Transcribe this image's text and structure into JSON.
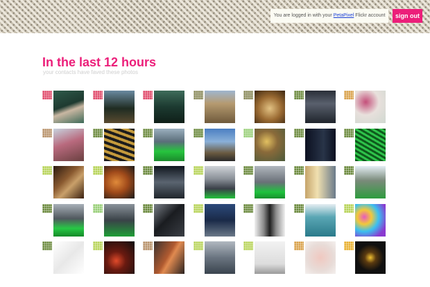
{
  "header": {
    "login_prefix": "You are logged in with your ",
    "login_link": "PetaPixel",
    "login_suffix": " Flickr account",
    "signout_label": "sign out"
  },
  "main": {
    "title": "In the last 12 hours",
    "subtitle": "your contacts have faved these photos"
  },
  "photos": [
    {
      "name": "woman-in-green-dress",
      "badge": "#e04a6a",
      "bg": "linear-gradient(160deg,#2e5a4a 0%,#1e3a30 45%,#c9b7a2 60%,#3d6a58 100%)"
    },
    {
      "name": "dark-trees",
      "badge": "#e04a6a",
      "bg": "linear-gradient(180deg,#6a8aa0 0%,#1f2c22 55%,#5a4a30 100%)"
    },
    {
      "name": "green-forest-road",
      "badge": "#e04a6a",
      "bg": "linear-gradient(180deg,#3e6b5a 0%,#1c3a30 50%,#0f1f18 100%)"
    },
    {
      "name": "rocky-mountain",
      "badge": "#8a8a5a",
      "bg": "linear-gradient(180deg,#9fb6cf 0%,#b59a70 40%,#6f5a3c 100%)"
    },
    {
      "name": "cathedral-interior",
      "badge": "#8a8a5a",
      "bg": "radial-gradient(circle at 50% 55%,#e2c283 0%,#9a6a32 50%,#3a2510 100%)"
    },
    {
      "name": "ballet-stage",
      "badge": "#6c8a3e",
      "bg": "linear-gradient(180deg,#2a2f38 0%,#59606d 40%,#20252c 100%)"
    },
    {
      "name": "roses",
      "badge": "#d9a14a",
      "bg": "radial-gradient(circle at 35% 35%,#c44f7a 0%,#e8e0dc 45%,#cfd8d0 100%)"
    },
    {
      "name": "pink-tree",
      "badge": "#b8926a",
      "bg": "linear-gradient(160deg,#c7d3df 0%,#b96a7e 45%,#6a4040 100%)"
    },
    {
      "name": "spiral-parking",
      "badge": "#6c8a3e",
      "bg": "repeating-linear-gradient(20deg,#1c1c1c 0 4px,#c49a3c 4px 8px)"
    },
    {
      "name": "green-river-boat",
      "badge": "#6c8a3e",
      "bg": "linear-gradient(180deg,#9bb0bf 0%,#5b6e7a 40%,#26c43e 70%,#1b8a2c 100%)"
    },
    {
      "name": "city-aerial",
      "badge": "#6c8a3e",
      "bg": "linear-gradient(180deg,#4b7fc2 0%,#8ab0d8 40%,#6a5a40 75%,#2a2a2a 100%)"
    },
    {
      "name": "jewelry",
      "badge": "#9ad07a",
      "bg": "radial-gradient(circle at 40% 40%,#e2c060 0%,#8a6a3a 40%,#4a5a3a 100%)"
    },
    {
      "name": "dark-room",
      "badge": "#6c8a3e",
      "bg": "linear-gradient(90deg,#0c1020 0%,#283448 60%,#0c1020 100%)"
    },
    {
      "name": "green-pattern",
      "badge": "#6c8a3e",
      "bg": "repeating-linear-gradient(30deg,#0e5a1c 0 3px,#2ec24a 3px 6px)"
    },
    {
      "name": "wooden-boxes",
      "badge": "#b8d45a",
      "bg": "linear-gradient(135deg,#2a1a10 0%,#8a5a30 40%,#c9a06a 60%,#3a2010 100%)"
    },
    {
      "name": "canyon",
      "badge": "#b8d45a",
      "bg": "radial-gradient(ellipse at 40% 50%,#e08a3a 0%,#a04a1a 45%,#1a1a1a 100%)"
    },
    {
      "name": "bridge-night",
      "badge": "#6c8a3e",
      "bg": "linear-gradient(180deg,#10161e 0%,#5a6470 50%,#20262c 100%)"
    },
    {
      "name": "foggy-skyline",
      "badge": "#b8d45a",
      "bg": "linear-gradient(180deg,#d0d4d8 0%,#8a9098 40%,#3a4048 70%,#22c03a 100%)"
    },
    {
      "name": "green-river-city",
      "badge": "#6c8a3e",
      "bg": "linear-gradient(180deg,#b0b6bd 0%,#6a7078 50%,#1fc23e 80%,#18902c 100%)"
    },
    {
      "name": "glass-tower",
      "badge": "#6c8a3e",
      "bg": "linear-gradient(90deg,#c6a46a 0%,#f0e0b0 40%,#6a7a8a 100%)"
    },
    {
      "name": "riverwalk",
      "badge": "#6c8a3e",
      "bg": "linear-gradient(180deg,#e4eef4 0%,#7a8a7a 45%,#2e9c3e 100%)"
    },
    {
      "name": "green-river-skyline",
      "badge": "#6c8a3e",
      "bg": "linear-gradient(180deg,#a8b0b8 0%,#50585e 45%,#27c845 75%,#158a28 100%)"
    },
    {
      "name": "green-canal",
      "badge": "#9ad07a",
      "bg": "linear-gradient(180deg,#8a929a 0%,#3a4248 50%,#1e9e36 100%)"
    },
    {
      "name": "black-tower",
      "badge": "#6c8a3e",
      "bg": "linear-gradient(135deg,#7a8088 0%,#1a1c20 45%,#3a3e44 100%)"
    },
    {
      "name": "blue-night-buildings",
      "badge": "#b8d45a",
      "bg": "linear-gradient(180deg,#2c4a7a 0%,#1a2a48 50%,#6a7888 100%)"
    },
    {
      "name": "silhouettes-mirror",
      "badge": "#6c8a3e",
      "bg": "linear-gradient(90deg,#f0f0f0 0%,#8a8a8a 30%,#202020 50%,#8a8a8a 70%,#f0f0f0 100%)"
    },
    {
      "name": "teal-water",
      "badge": "#6c8a3e",
      "bg": "linear-gradient(180deg,#e6eef2 0%,#5aa6b4 40%,#2a7a8a 100%)"
    },
    {
      "name": "colorful-bubbles",
      "badge": "#b8d45a",
      "bg": "radial-gradient(circle at 30% 40%,#e85ac0 0%,#f2c83a 25%,#3ac0f0 50%,#8a3ad0 80%)"
    },
    {
      "name": "line-drawing",
      "badge": "#6c8a3e",
      "bg": "linear-gradient(135deg,#ffffff 0%,#e8e8e8 50%,#ffffff 100%)"
    },
    {
      "name": "red-sparks",
      "badge": "#b8d45a",
      "bg": "radial-gradient(circle at 40% 60%,#e04a2a 0%,#6a1a10 35%,#0e0e0e 100%)"
    },
    {
      "name": "rust-diagonal",
      "badge": "#b8926a",
      "bg": "linear-gradient(120deg,#3a3230 0%,#b05a30 45%,#e08a50 55%,#2a2220 100%)"
    },
    {
      "name": "wet-street",
      "badge": "#b8d45a",
      "bg": "linear-gradient(180deg,#b0b8c0 0%,#6a7480 50%,#3a444e 100%)"
    },
    {
      "name": "snow-tree",
      "badge": "#b8d45a",
      "bg": "linear-gradient(180deg,#f2f2f2 0%,#dcdcdc 70%,#9a9a9a 100%)"
    },
    {
      "name": "pink-flowers",
      "badge": "#d9a14a",
      "bg": "radial-gradient(circle at 50% 50%,#f0c8c0 0%,#e8dcd8 60%,#f4f0ee 100%)"
    },
    {
      "name": "gold-ring",
      "badge": "#e8b030",
      "bg": "radial-gradient(circle at 50% 50%,#f0c030 0%,#5a3a10 25%,#101010 60%)"
    }
  ]
}
